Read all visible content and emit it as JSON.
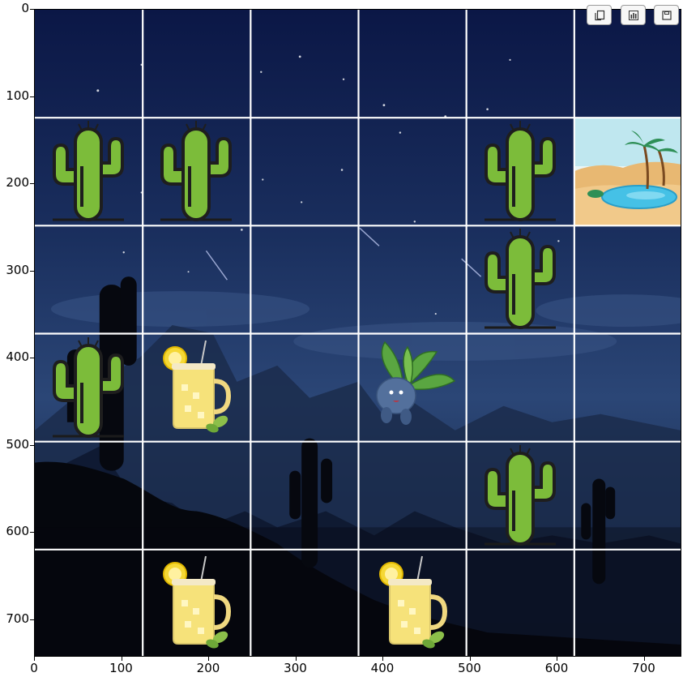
{
  "plot": {
    "axes": {
      "x_ticks": [
        "0",
        "100",
        "200",
        "300",
        "400",
        "500",
        "600",
        "700"
      ],
      "y_ticks": [
        "0",
        "100",
        "200",
        "300",
        "400",
        "500",
        "600",
        "700"
      ]
    },
    "grid": {
      "rows": 6,
      "cols": 6,
      "cells": [
        {
          "row": 1,
          "col": 0,
          "sprite": "cactus"
        },
        {
          "row": 1,
          "col": 1,
          "sprite": "cactus"
        },
        {
          "row": 1,
          "col": 4,
          "sprite": "cactus"
        },
        {
          "row": 1,
          "col": 5,
          "sprite": "oasis"
        },
        {
          "row": 2,
          "col": 4,
          "sprite": "cactus"
        },
        {
          "row": 3,
          "col": 0,
          "sprite": "cactus"
        },
        {
          "row": 3,
          "col": 1,
          "sprite": "lemonade"
        },
        {
          "row": 3,
          "col": 3,
          "sprite": "oddish-agent"
        },
        {
          "row": 4,
          "col": 4,
          "sprite": "cactus"
        },
        {
          "row": 5,
          "col": 1,
          "sprite": "lemonade"
        },
        {
          "row": 5,
          "col": 3,
          "sprite": "lemonade"
        }
      ]
    },
    "colors": {
      "sky_top": "#0d1a4a",
      "sky_mid": "#1e3461",
      "sky_low": "#2a4574",
      "silhouette": "#05070d",
      "grid_line": "#ffffff",
      "cactus_green": "#7cbc3a",
      "lemonade_yellow": "#f6e27a"
    }
  },
  "toolbar": [
    {
      "icon": "copy-icon"
    },
    {
      "icon": "bar-chart-icon"
    },
    {
      "icon": "save-icon"
    }
  ]
}
